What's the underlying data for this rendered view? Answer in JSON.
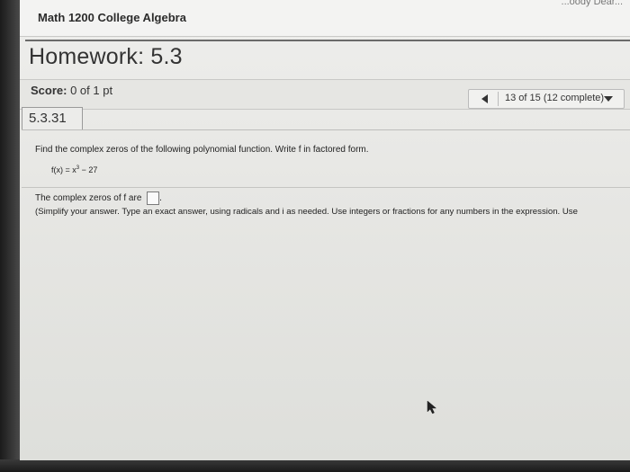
{
  "header": {
    "course_title": "Math 1200 College Algebra",
    "corner_text": "...oody Dear..."
  },
  "assignment": {
    "title": "Homework: 5.3"
  },
  "score": {
    "label": "Score:",
    "value": "0 of 1 pt"
  },
  "navigation": {
    "progress_text": "13 of 15 (12 complete)",
    "prev_icon": "triangle-left-icon",
    "dropdown_icon": "triangle-down-icon"
  },
  "question": {
    "number": "5.3.31",
    "prompt": "Find the complex zeros of the following polynomial function. Write f in factored form.",
    "function_lhs": "f(x) = x",
    "function_exponent": "3",
    "function_rhs": " − 27",
    "answer_prefix": "The complex zeros of f are",
    "answer_suffix": ".",
    "answer_value": "",
    "instructions": "(Simplify your answer. Type an exact answer, using radicals and i as needed. Use integers or fractions for any numbers in the expression. Use"
  },
  "colors": {
    "screen_bg": "#e7e7e4",
    "text": "#222222",
    "bezel": "#2a2a2a"
  }
}
